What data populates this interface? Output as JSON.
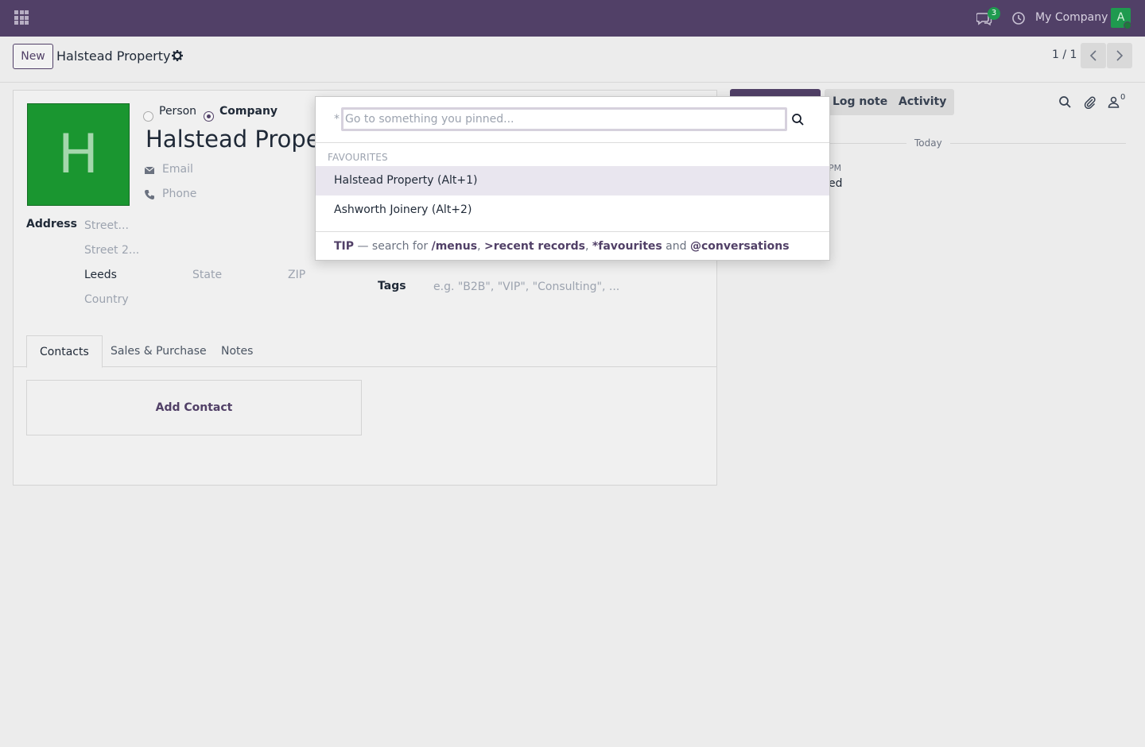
{
  "navbar": {
    "chat_badge": "3",
    "company": "My Company",
    "avatar_initial": "A",
    "brand_color": "#514067"
  },
  "control_panel": {
    "new_label": "New",
    "record_title": "Halstead Property",
    "pager": "1 / 1"
  },
  "form": {
    "avatar_letter": "H",
    "radio_person": "Person",
    "radio_company": "Company",
    "selected_type": "Company",
    "name": "Halstead Property",
    "email_placeholder": "Email",
    "phone_placeholder": "Phone",
    "address_label": "Address",
    "street_placeholder": "Street...",
    "street2_placeholder": "Street 2...",
    "city": "Leeds",
    "state_placeholder": "State",
    "zip_placeholder": "ZIP",
    "country_placeholder": "Country",
    "tags_label": "Tags",
    "tags_placeholder": "e.g. \"B2B\", \"VIP\", \"Consulting\", ...",
    "tabs": [
      "Contacts",
      "Sales & Purchase",
      "Notes"
    ],
    "active_tab": "Contacts",
    "add_contact": "Add Contact"
  },
  "chatter": {
    "log_note": "Log note",
    "activity": "Activity",
    "follower_count": "0",
    "today": "Today",
    "time_fragment": "PM",
    "message_fragment": "ed"
  },
  "palette": {
    "prefix": "*",
    "placeholder": "Go to something you pinned...",
    "section_title": "FAVOURITES",
    "items": [
      {
        "label": "Halstead Property (Alt+1)",
        "selected": true
      },
      {
        "label": "Ashworth Joinery (Alt+2)",
        "selected": false
      }
    ],
    "tip": {
      "label": "TIP",
      "dash": " — search for ",
      "menus": "/menus",
      "sep1": ", ",
      "recent": ">recent records",
      "sep2": ", ",
      "favourites": "*favourites",
      "and": " and ",
      "conversations": "@conversations"
    }
  }
}
